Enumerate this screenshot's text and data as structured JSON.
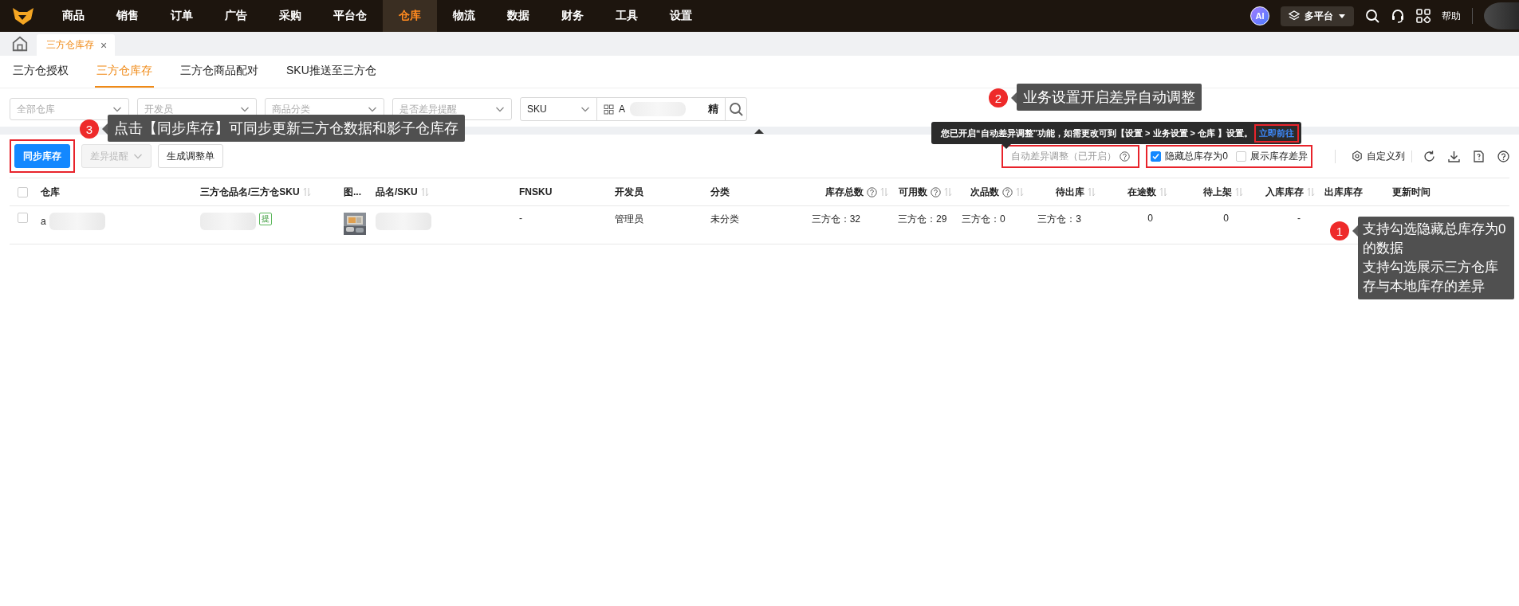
{
  "nav": {
    "items": [
      {
        "label": "商品",
        "selected": false
      },
      {
        "label": "销售",
        "selected": false
      },
      {
        "label": "订单",
        "selected": false
      },
      {
        "label": "广告",
        "selected": false
      },
      {
        "label": "采购",
        "selected": false
      },
      {
        "label": "平台仓",
        "selected": false
      },
      {
        "label": "仓库",
        "selected": true
      },
      {
        "label": "物流",
        "selected": false
      },
      {
        "label": "数据",
        "selected": false
      },
      {
        "label": "财务",
        "selected": false
      },
      {
        "label": "工具",
        "selected": false
      },
      {
        "label": "设置",
        "selected": false
      }
    ],
    "ai_badge": "AI",
    "platform": "多平台",
    "help": "帮助"
  },
  "page_tabs": [
    {
      "label": "三方仓库存",
      "selected": true,
      "close": "×"
    }
  ],
  "sub_tabs": [
    {
      "label": "三方仓授权",
      "selected": false
    },
    {
      "label": "三方仓库存",
      "selected": true
    },
    {
      "label": "三方仓商品配对",
      "selected": false
    },
    {
      "label": "SKU推送至三方仓",
      "selected": false
    }
  ],
  "filters": [
    {
      "placeholder": "全部仓库"
    },
    {
      "placeholder": "开发员"
    },
    {
      "placeholder": "商品分类"
    },
    {
      "placeholder": "是否差异提醒"
    }
  ],
  "search": {
    "field": "SKU",
    "value": "A",
    "mode": "精"
  },
  "toolbar": {
    "buttons": [
      {
        "label": "同步库存",
        "kind": "primary",
        "disabled": false,
        "highlight": true
      },
      {
        "label": "差异提醒",
        "kind": "dropdown",
        "disabled": true,
        "highlight": false
      },
      {
        "label": "生成调整单",
        "kind": "default",
        "disabled": false,
        "highlight": false
      }
    ],
    "auto_adjust": {
      "label": "自动差异调整（已开启）",
      "highlight": true
    },
    "checkboxes": [
      {
        "label": "隐藏总库存为0",
        "checked": true
      },
      {
        "label": "展示库存差异",
        "checked": false
      }
    ],
    "checkboxes_highlight": true,
    "custom_columns": "自定义列"
  },
  "notice": {
    "text": "您已开启“自动差异调整”功能，如需更改可到【设置 > 业务设置 > 仓库 】设置。",
    "link": "立即前往",
    "link_highlight": true
  },
  "table": {
    "select_all": false,
    "columns": [
      {
        "label": "仓库",
        "kind": "text",
        "help": false,
        "sortable": false
      },
      {
        "label": "三方仓品名/三方仓SKU",
        "kind": "text",
        "help": false,
        "sortable": true
      },
      {
        "label": "图...",
        "help": false,
        "sortable": false
      },
      {
        "label": "品名/SKU",
        "kind": "text",
        "help": false,
        "sortable": true
      },
      {
        "label": "FNSKU",
        "kind": "text",
        "help": false,
        "sortable": false
      },
      {
        "label": "开发员",
        "kind": "text",
        "help": false,
        "sortable": false
      },
      {
        "label": "分类",
        "kind": "text",
        "help": false,
        "sortable": false
      },
      {
        "label": "库存总数",
        "kind": "number",
        "help": true,
        "sortable": true
      },
      {
        "label": "可用数",
        "kind": "number",
        "help": true,
        "sortable": true
      },
      {
        "label": "次品数",
        "kind": "number",
        "help": true,
        "sortable": true
      },
      {
        "label": "待出库",
        "kind": "number",
        "help": false,
        "sortable": true
      },
      {
        "label": "在途数",
        "kind": "number",
        "help": false,
        "sortable": true
      },
      {
        "label": "待上架",
        "kind": "number",
        "help": false,
        "sortable": true
      },
      {
        "label": "入库库存",
        "kind": "number",
        "help": false,
        "sortable": true
      },
      {
        "label": "出库库存",
        "kind": "text",
        "help": false,
        "sortable": false
      },
      {
        "label": "更新时间",
        "kind": "text",
        "help": false,
        "sortable": false
      }
    ],
    "rows": [
      {
        "checked": false,
        "cells": [
          {
            "kind": "blurred",
            "text": "a"
          },
          {
            "kind": "blurred",
            "tag": "提"
          },
          {
            "kind": "picture"
          },
          {
            "kind": "blurred"
          },
          {
            "kind": "text",
            "text": "-"
          },
          {
            "kind": "text",
            "text": "管理员"
          },
          {
            "kind": "text",
            "text": "未分类"
          },
          {
            "kind": "text",
            "text": "三方仓：32"
          },
          {
            "kind": "text",
            "text": "三方仓：29"
          },
          {
            "kind": "text",
            "text": "三方仓：0"
          },
          {
            "kind": "text",
            "text": "三方仓：3"
          },
          {
            "kind": "text",
            "text": "0"
          },
          {
            "kind": "text",
            "text": "0"
          },
          {
            "kind": "text",
            "text": "-"
          },
          {
            "kind": "empty"
          },
          {
            "kind": "empty"
          }
        ]
      }
    ]
  },
  "callouts": [
    {
      "number": "3",
      "lines": [
        "点击【同步库存】可同步更新三方仓数据和影子仓库存"
      ]
    },
    {
      "number": "2",
      "lines": [
        "业务设置开启差异自动调整"
      ]
    },
    {
      "number": "1",
      "lines": [
        "支持勾选隐藏总库存为0的数据",
        "支持勾选展示三方仓库存与本地库存的差异"
      ]
    }
  ]
}
